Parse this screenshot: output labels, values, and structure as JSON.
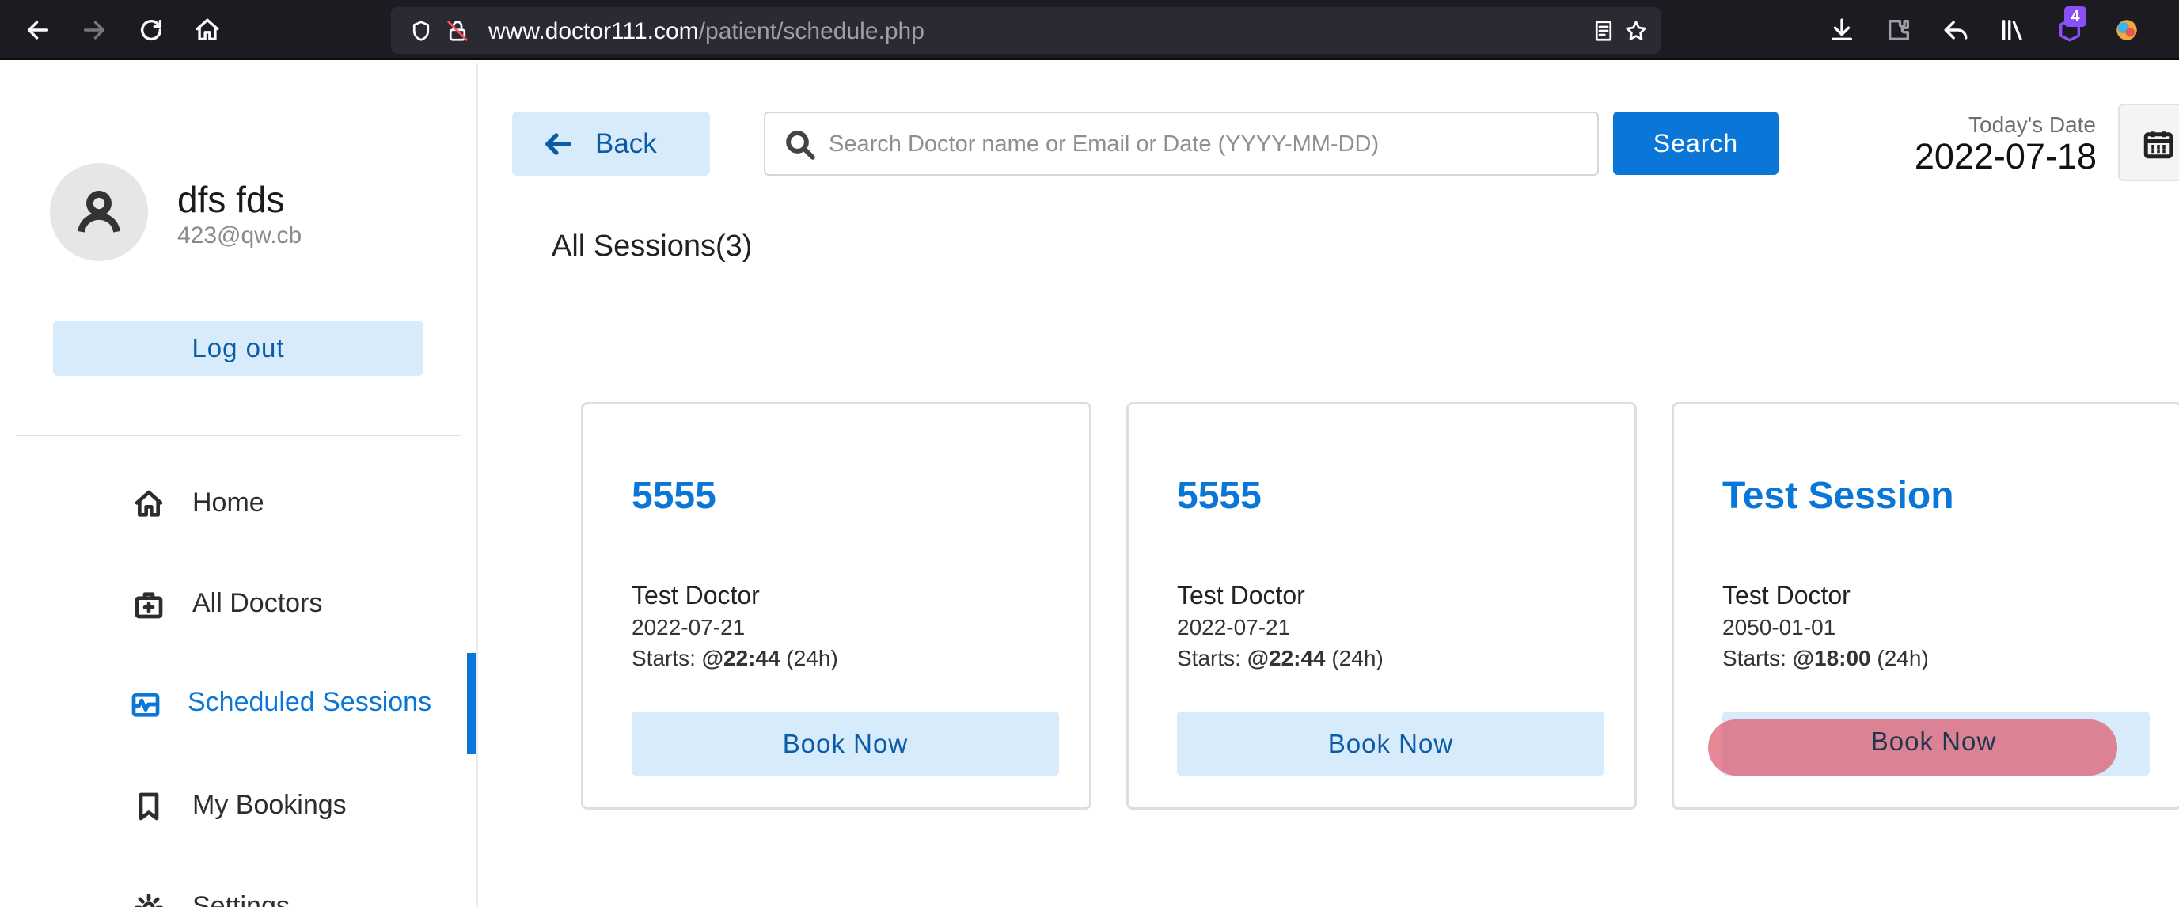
{
  "browser": {
    "url_host": "www.doctor111.com",
    "url_path": "/patient/schedule.php",
    "extension_badge": "4"
  },
  "user": {
    "name": "dfs fds",
    "email": "423@qw.cb",
    "logout_label": "Log out"
  },
  "menu": [
    {
      "label": "Home",
      "icon": "home-icon"
    },
    {
      "label": "All Doctors",
      "icon": "doctor-kit-icon"
    },
    {
      "label": "Scheduled Sessions",
      "icon": "schedule-pulse-icon",
      "active": true
    },
    {
      "label": "My Bookings",
      "icon": "bookmark-icon"
    },
    {
      "label": "Settings",
      "icon": "gear-icon"
    }
  ],
  "toolbar": {
    "back_label": "Back",
    "search_placeholder": "Search Doctor name or Email or Date (YYYY-MM-DD)",
    "search_label": "Search",
    "today_label": "Today's Date",
    "today_value": "2022-07-18"
  },
  "section": {
    "title": "All Sessions(3)"
  },
  "sessions": [
    {
      "title": "5555",
      "doctor": "Test Doctor",
      "date": "2022-07-21",
      "starts_prefix": "Starts: ",
      "time": "@22:44",
      "suffix": " (24h)",
      "button": "Book Now"
    },
    {
      "title": "5555",
      "doctor": "Test Doctor",
      "date": "2022-07-21",
      "starts_prefix": "Starts: ",
      "time": "@22:44",
      "suffix": " (24h)",
      "button": "Book Now"
    },
    {
      "title": "Test Session",
      "doctor": "Test Doctor",
      "date": "2050-01-01",
      "starts_prefix": "Starts: ",
      "time": "@18:00",
      "suffix": " (24h)",
      "button": "Book Now"
    }
  ],
  "colors": {
    "accent": "#0a76d8",
    "soft_button": "#d8ebfa",
    "highlight": "#dc5a6e"
  }
}
